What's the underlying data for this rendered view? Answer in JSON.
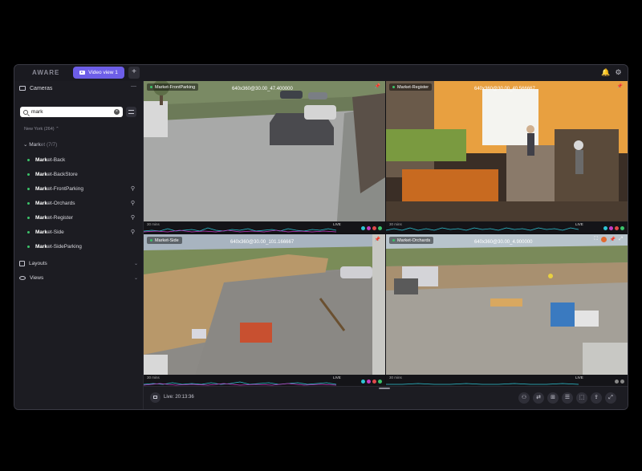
{
  "app": {
    "brand": "AWARE"
  },
  "tabs": {
    "active_label": "Video view 1",
    "add_label": "+"
  },
  "topbar": {
    "icons": [
      "bell-icon",
      "gear-icon"
    ]
  },
  "sidebar": {
    "cameras_label": "Cameras",
    "search": {
      "value": "mark",
      "placeholder": ""
    },
    "region": "New York (264)",
    "group": {
      "name_match": "Mark",
      "name_rest": "et",
      "count": "(7/7)"
    },
    "cameras": [
      {
        "match": "Mark",
        "rest": "et-Back",
        "pinned": false
      },
      {
        "match": "Mark",
        "rest": "et-BackStore",
        "pinned": false
      },
      {
        "match": "Mark",
        "rest": "et-FrontParking",
        "pinned": true
      },
      {
        "match": "Mark",
        "rest": "et-Orchards",
        "pinned": true
      },
      {
        "match": "Mark",
        "rest": "et-Register",
        "pinned": true
      },
      {
        "match": "Mark",
        "rest": "et-Side",
        "pinned": true
      },
      {
        "match": "Mark",
        "rest": "et-SideParking",
        "pinned": false
      }
    ],
    "sections": [
      {
        "label": "Layouts"
      },
      {
        "label": "Views"
      }
    ]
  },
  "tiles": [
    {
      "name": "Market-FrontParking",
      "res": "640x360@30.00_47.400000",
      "tl": "30 mins",
      "live": "LIVE"
    },
    {
      "name": "Market-Register",
      "res": "640x360@30.00_40.566667",
      "tl": "30 mins",
      "live": "LIVE"
    },
    {
      "name": "Market-Side",
      "res": "640x360@30.00_101.166667",
      "tl": "30 mins",
      "live": "LIVE"
    },
    {
      "name": "Market-Orchards",
      "res": "640x360@30.00_4.900000",
      "tl": "30 mins",
      "live": "LIVE"
    }
  ],
  "bottombar": {
    "live_time": "Live: 20:13:36"
  },
  "colors": {
    "accent": "#6d5ee8",
    "status_green": "#3cc46a",
    "waveform_cyan": "#2ec4d4",
    "waveform_magenta": "#c43cc4"
  }
}
